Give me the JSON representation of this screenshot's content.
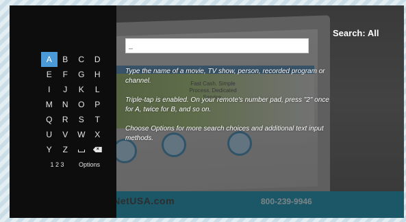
{
  "search": {
    "title": "Search: All",
    "input_value": ""
  },
  "keyboard": {
    "rows": [
      [
        "A",
        "B",
        "C",
        "D"
      ],
      [
        "E",
        "F",
        "G",
        "H"
      ],
      [
        "I",
        "J",
        "K",
        "L"
      ],
      [
        "M",
        "N",
        "O",
        "P"
      ],
      [
        "Q",
        "R",
        "S",
        "T"
      ],
      [
        "U",
        "V",
        "W",
        "X"
      ],
      [
        "Y",
        "Z"
      ]
    ],
    "selected_key": "A",
    "numbers_label": "1 2 3",
    "options_label": "Options",
    "space_icon": "space-icon",
    "backspace_icon": "backspace-icon"
  },
  "instructions": [
    "Type the name of a movie, TV show, person, recorded program or channel.",
    "Triple-tap is enabled.  On your remote's number pad, press \"2\" once for A, twice for B, and so on.",
    "Choose Options for more search choices and additional text input methods."
  ],
  "background": {
    "brand": "CashNetUSA.com",
    "phone": "800-239-9946",
    "hero_tagline": "Fast Cash. Simple Process. Dedicated Service."
  },
  "colors": {
    "selected_key": "#4a9ad8",
    "panel": "#0d0d0d",
    "footer_band": "#2e8da6"
  }
}
